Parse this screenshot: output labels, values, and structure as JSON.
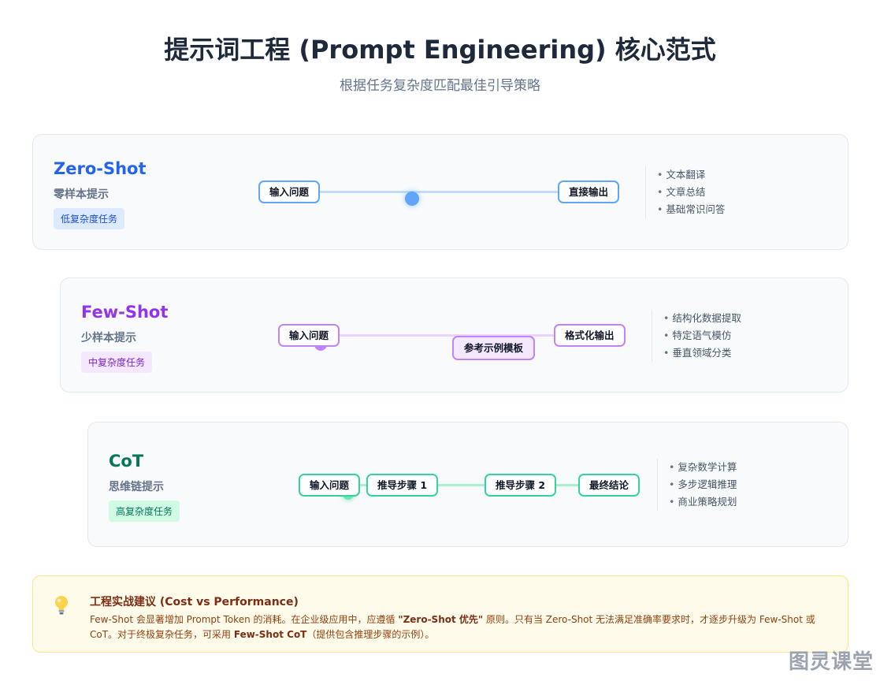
{
  "header": {
    "title": "提示词工程 (Prompt Engineering) 核心范式",
    "subtitle": "根据任务复杂度匹配最佳引导策略"
  },
  "colors": {
    "zero_shot": "#2563eb",
    "few_shot": "#9333ea",
    "cot": "#059669"
  },
  "paradigms": [
    {
      "name": "Zero-Shot",
      "cn_name": "零样本提示",
      "complexity": "低复杂度任务",
      "flow": {
        "input": "输入问题",
        "output": "直接输出"
      },
      "use_cases": [
        "文本翻译",
        "文章总结",
        "基础常识问答"
      ]
    },
    {
      "name": "Few-Shot",
      "cn_name": "少样本提示",
      "complexity": "中复杂度任务",
      "flow": {
        "input": "输入问题",
        "example": "参考示例模板",
        "output": "格式化输出"
      },
      "use_cases": [
        "结构化数据提取",
        "特定语气模仿",
        "垂直领域分类"
      ]
    },
    {
      "name": "CoT",
      "cn_name": "思维链提示",
      "complexity": "高复杂度任务",
      "flow": {
        "input": "输入问题",
        "step1": "推导步骤 1",
        "step2": "推导步骤 2",
        "output": "最终结论"
      },
      "use_cases": [
        "复杂数学计算",
        "多步逻辑推理",
        "商业策略规划"
      ]
    }
  ],
  "tip": {
    "icon": "lightbulb-icon",
    "title": "工程实战建议 (Cost vs Performance)",
    "text_1": "Few-Shot 会显著增加 Prompt Token 的消耗。在企业级应用中，应遵循 ",
    "bold_1": "\"Zero-Shot 优先\"",
    "text_2": " 原则。只有当 Zero-Shot 无法满足准确率要求时，才逐步升级为 Few-Shot 或 CoT。对于终极复杂任务，可采用 ",
    "bold_2": "Few-Shot CoT",
    "text_3": "（提供包含推理步骤的示例）。"
  },
  "watermark": "图灵课堂"
}
